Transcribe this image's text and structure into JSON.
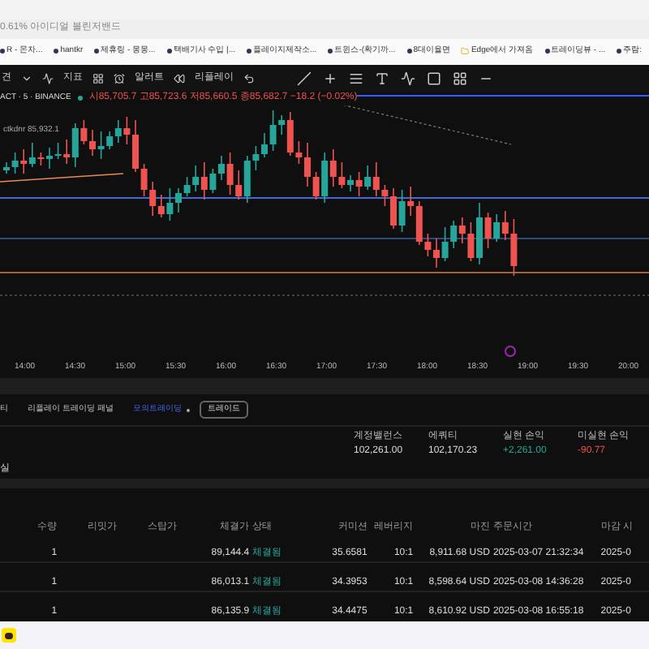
{
  "browser": {
    "page_title": "0.61% 아이디얼 볼린저밴드",
    "bookmarks": [
      "R - 몬차...",
      "hantkr",
      "제휴링 - 몽몽...",
      "택배기사 수입 |...",
      "플레이지제작소...",
      "트윈스-(확기까...",
      "8대이율면",
      "Edge에서 가져옴",
      "트레이딩뷰 - ...",
      "주람:"
    ]
  },
  "toolbar": {
    "items": [
      "견",
      "지표",
      "알러트",
      "리플레이"
    ]
  },
  "chart": {
    "symbol": "ACT · 5 · BINANCE",
    "ohlc": "시85,705.7 고85,723.6 저85,660.5 종85,682.7 −18.2 (−0.02%)",
    "indicator": "ctkdnr 85,932.1",
    "time_labels": [
      "14:00",
      "14:30",
      "15:00",
      "15:30",
      "16:00",
      "16:30",
      "17:00",
      "17:30",
      "18:00",
      "18:30",
      "19:00",
      "19:30",
      "20:00"
    ]
  },
  "panel": {
    "tabs": [
      {
        "label": "티",
        "selected": false
      },
      {
        "label": "리플레이 트레이딩 패널",
        "selected": false
      },
      {
        "label": "모의트레이딩",
        "selected": true
      }
    ],
    "trade_button": "트레이드",
    "summary": [
      {
        "label": "계정밸런스",
        "value": "102,261.00",
        "color": "#dddddd"
      },
      {
        "label": "에쿼티",
        "value": "102,170.23",
        "color": "#dddddd"
      },
      {
        "label": "실현 손익",
        "value": "+2,261.00",
        "color": "#26a69a"
      },
      {
        "label": "미실현 손익",
        "value": "-90.77",
        "color": "#ef5350"
      }
    ],
    "section": "실"
  },
  "table": {
    "columns": [
      "수량",
      "리밋가",
      "스탑가",
      "체결가",
      "상태",
      "커미션",
      "레버리지",
      "마진",
      "주문시간",
      "마감 시"
    ],
    "rows": [
      [
        "1",
        "",
        "",
        "89,144.4",
        "체결됨",
        "35.6581",
        "10:1",
        "8,911.68 USD",
        "2025-03-07 21:32:34",
        "2025-0"
      ],
      [
        "1",
        "",
        "",
        "86,013.1",
        "체결됨",
        "34.3953",
        "10:1",
        "8,598.64 USD",
        "2025-03-08 14:36:28",
        "2025-0"
      ],
      [
        "1",
        "",
        "",
        "86,135.9",
        "체결됨",
        "34.4475",
        "10:1",
        "8,610.92 USD",
        "2025-03-08 16:55:18",
        "2025-0"
      ]
    ]
  }
}
